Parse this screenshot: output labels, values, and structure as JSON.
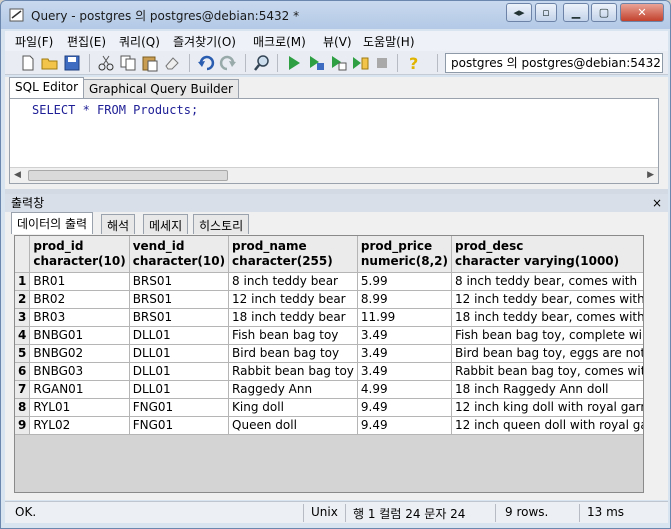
{
  "window": {
    "title": "Query - postgres 의 postgres@debian:5432 *",
    "accent": "#b3c9e6"
  },
  "menu": [
    "파일(F)",
    "편집(E)",
    "쿼리(Q)",
    "즐겨찾기(O)",
    "매크로(M)",
    "뷰(V)",
    "도움말(H)"
  ],
  "toolbar": {
    "icons": [
      "new-file-icon",
      "open-folder-icon",
      "save-icon",
      "cut-icon",
      "copy-icon",
      "paste-icon",
      "eraser-icon",
      "undo-icon",
      "redo-icon",
      "find-icon",
      "execute-icon",
      "execute-pgscript-icon",
      "execute-to-file-icon",
      "explain-icon",
      "cancel-query-icon",
      "help-icon"
    ],
    "connection": "postgres 의 postgres@debian:5432"
  },
  "editor_tabs": [
    "SQL Editor",
    "Graphical Query Builder"
  ],
  "sql": "SELECT * FROM Products;",
  "output": {
    "header": "출력창",
    "close": "×",
    "tabs": [
      "데이터의 출력",
      "해석",
      "메세지",
      "히스토리"
    ]
  },
  "table": {
    "columns": [
      {
        "name": "prod_id",
        "type": "character(10)"
      },
      {
        "name": "vend_id",
        "type": "character(10)"
      },
      {
        "name": "prod_name",
        "type": "character(255)"
      },
      {
        "name": "prod_price",
        "type": "numeric(8,2)"
      },
      {
        "name": "prod_desc",
        "type": "character varying(1000)"
      }
    ],
    "rows": [
      [
        "1",
        "BR01",
        "BRS01",
        "8 inch teddy bear",
        "5.99",
        "8 inch teddy bear, comes with"
      ],
      [
        "2",
        "BR02",
        "BRS01",
        "12 inch teddy bear",
        "8.99",
        "12 inch teddy bear, comes with"
      ],
      [
        "3",
        "BR03",
        "BRS01",
        "18 inch teddy bear",
        "11.99",
        "18 inch teddy bear, comes with"
      ],
      [
        "4",
        "BNBG01",
        "DLL01",
        "Fish bean bag toy",
        "3.49",
        "Fish bean bag toy, complete wi"
      ],
      [
        "5",
        "BNBG02",
        "DLL01",
        "Bird bean bag toy",
        "3.49",
        "Bird bean bag toy, eggs are not"
      ],
      [
        "6",
        "BNBG03",
        "DLL01",
        "Rabbit bean bag toy",
        "3.49",
        "Rabbit bean bag toy, comes wit"
      ],
      [
        "7",
        "RGAN01",
        "DLL01",
        "Raggedy Ann",
        "4.99",
        "18 inch Raggedy Ann doll"
      ],
      [
        "8",
        "RYL01",
        "FNG01",
        "King doll",
        "9.49",
        "12 inch king doll with royal garm"
      ],
      [
        "9",
        "RYL02",
        "FNG01",
        "Queen doll",
        "9.49",
        "12 inch queen doll with royal ga"
      ]
    ]
  },
  "status": {
    "message": "OK.",
    "encoding": "Unix",
    "position": "행 1 컬럼 24 문자 24",
    "rows": "9 rows.",
    "time": "13 ms"
  }
}
